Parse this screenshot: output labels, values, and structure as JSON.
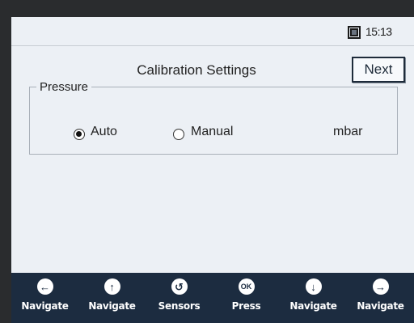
{
  "status": {
    "time": "15:13",
    "icon": "device-status-icon"
  },
  "header": {
    "title": "Calibration Settings",
    "next_label": "Next"
  },
  "pressure": {
    "legend": "Pressure",
    "options": [
      {
        "label": "Auto",
        "selected": true
      },
      {
        "label": "Manual",
        "selected": false
      }
    ],
    "unit": "mbar"
  },
  "toolbar": {
    "items": [
      {
        "label": "Navigate",
        "icon": "arrow-left-icon",
        "glyph": "←"
      },
      {
        "label": "Navigate",
        "icon": "arrow-up-icon",
        "glyph": "↑"
      },
      {
        "label": "Sensors",
        "icon": "sensors-icon",
        "glyph": "↺"
      },
      {
        "label": "Press",
        "icon": "ok-icon",
        "glyph": "OK"
      },
      {
        "label": "Navigate",
        "icon": "arrow-down-icon",
        "glyph": "↓"
      },
      {
        "label": "Navigate",
        "icon": "arrow-right-icon",
        "glyph": "→"
      }
    ]
  }
}
